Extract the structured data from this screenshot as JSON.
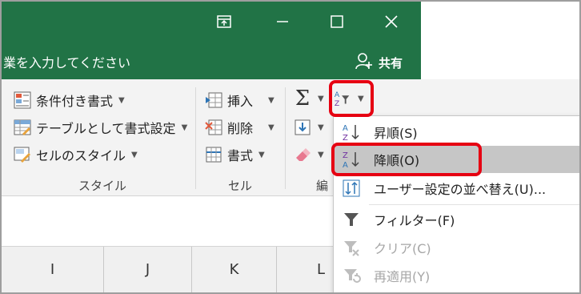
{
  "titlebar": {
    "tellme_text": "業を入力してください",
    "share_label": "共有"
  },
  "ribbon": {
    "styles_group": {
      "items": [
        "条件付き書式",
        "テーブルとして書式設定",
        "セルのスタイル"
      ],
      "label": "スタイル"
    },
    "cells_group": {
      "items": [
        "挿入",
        "削除",
        "書式"
      ],
      "label": "セル"
    },
    "editing_group": {
      "label": "編"
    }
  },
  "sort_menu": {
    "items": [
      {
        "label": "昇順(S)",
        "icon": "sort-ascending-icon",
        "enabled": true
      },
      {
        "label": "降順(O)",
        "icon": "sort-descending-icon",
        "enabled": true,
        "highlighted": true
      },
      {
        "label": "ユーザー設定の並べ替え(U)...",
        "icon": "custom-sort-icon",
        "enabled": true
      },
      {
        "label": "フィルター(F)",
        "icon": "filter-icon",
        "enabled": true
      },
      {
        "label": "クリア(C)",
        "icon": "clear-filter-icon",
        "enabled": false
      },
      {
        "label": "再適用(Y)",
        "icon": "reapply-filter-icon",
        "enabled": false
      }
    ]
  },
  "columns": [
    "I",
    "J",
    "K",
    "L"
  ],
  "colors": {
    "title_green": "#217346",
    "highlight_red": "#e60012",
    "menu_highlight": "#c6c6c6"
  }
}
